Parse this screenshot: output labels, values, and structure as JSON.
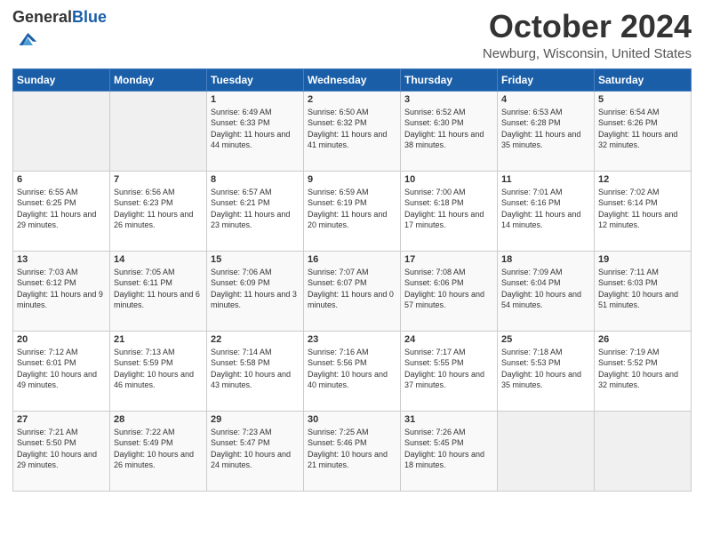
{
  "header": {
    "logo_general": "General",
    "logo_blue": "Blue",
    "month_title": "October 2024",
    "location": "Newburg, Wisconsin, United States"
  },
  "days_of_week": [
    "Sunday",
    "Monday",
    "Tuesday",
    "Wednesday",
    "Thursday",
    "Friday",
    "Saturday"
  ],
  "weeks": [
    [
      {
        "day": "",
        "sunrise": "",
        "sunset": "",
        "daylight": ""
      },
      {
        "day": "",
        "sunrise": "",
        "sunset": "",
        "daylight": ""
      },
      {
        "day": "1",
        "sunrise": "Sunrise: 6:49 AM",
        "sunset": "Sunset: 6:33 PM",
        "daylight": "Daylight: 11 hours and 44 minutes."
      },
      {
        "day": "2",
        "sunrise": "Sunrise: 6:50 AM",
        "sunset": "Sunset: 6:32 PM",
        "daylight": "Daylight: 11 hours and 41 minutes."
      },
      {
        "day": "3",
        "sunrise": "Sunrise: 6:52 AM",
        "sunset": "Sunset: 6:30 PM",
        "daylight": "Daylight: 11 hours and 38 minutes."
      },
      {
        "day": "4",
        "sunrise": "Sunrise: 6:53 AM",
        "sunset": "Sunset: 6:28 PM",
        "daylight": "Daylight: 11 hours and 35 minutes."
      },
      {
        "day": "5",
        "sunrise": "Sunrise: 6:54 AM",
        "sunset": "Sunset: 6:26 PM",
        "daylight": "Daylight: 11 hours and 32 minutes."
      }
    ],
    [
      {
        "day": "6",
        "sunrise": "Sunrise: 6:55 AM",
        "sunset": "Sunset: 6:25 PM",
        "daylight": "Daylight: 11 hours and 29 minutes."
      },
      {
        "day": "7",
        "sunrise": "Sunrise: 6:56 AM",
        "sunset": "Sunset: 6:23 PM",
        "daylight": "Daylight: 11 hours and 26 minutes."
      },
      {
        "day": "8",
        "sunrise": "Sunrise: 6:57 AM",
        "sunset": "Sunset: 6:21 PM",
        "daylight": "Daylight: 11 hours and 23 minutes."
      },
      {
        "day": "9",
        "sunrise": "Sunrise: 6:59 AM",
        "sunset": "Sunset: 6:19 PM",
        "daylight": "Daylight: 11 hours and 20 minutes."
      },
      {
        "day": "10",
        "sunrise": "Sunrise: 7:00 AM",
        "sunset": "Sunset: 6:18 PM",
        "daylight": "Daylight: 11 hours and 17 minutes."
      },
      {
        "day": "11",
        "sunrise": "Sunrise: 7:01 AM",
        "sunset": "Sunset: 6:16 PM",
        "daylight": "Daylight: 11 hours and 14 minutes."
      },
      {
        "day": "12",
        "sunrise": "Sunrise: 7:02 AM",
        "sunset": "Sunset: 6:14 PM",
        "daylight": "Daylight: 11 hours and 12 minutes."
      }
    ],
    [
      {
        "day": "13",
        "sunrise": "Sunrise: 7:03 AM",
        "sunset": "Sunset: 6:12 PM",
        "daylight": "Daylight: 11 hours and 9 minutes."
      },
      {
        "day": "14",
        "sunrise": "Sunrise: 7:05 AM",
        "sunset": "Sunset: 6:11 PM",
        "daylight": "Daylight: 11 hours and 6 minutes."
      },
      {
        "day": "15",
        "sunrise": "Sunrise: 7:06 AM",
        "sunset": "Sunset: 6:09 PM",
        "daylight": "Daylight: 11 hours and 3 minutes."
      },
      {
        "day": "16",
        "sunrise": "Sunrise: 7:07 AM",
        "sunset": "Sunset: 6:07 PM",
        "daylight": "Daylight: 11 hours and 0 minutes."
      },
      {
        "day": "17",
        "sunrise": "Sunrise: 7:08 AM",
        "sunset": "Sunset: 6:06 PM",
        "daylight": "Daylight: 10 hours and 57 minutes."
      },
      {
        "day": "18",
        "sunrise": "Sunrise: 7:09 AM",
        "sunset": "Sunset: 6:04 PM",
        "daylight": "Daylight: 10 hours and 54 minutes."
      },
      {
        "day": "19",
        "sunrise": "Sunrise: 7:11 AM",
        "sunset": "Sunset: 6:03 PM",
        "daylight": "Daylight: 10 hours and 51 minutes."
      }
    ],
    [
      {
        "day": "20",
        "sunrise": "Sunrise: 7:12 AM",
        "sunset": "Sunset: 6:01 PM",
        "daylight": "Daylight: 10 hours and 49 minutes."
      },
      {
        "day": "21",
        "sunrise": "Sunrise: 7:13 AM",
        "sunset": "Sunset: 5:59 PM",
        "daylight": "Daylight: 10 hours and 46 minutes."
      },
      {
        "day": "22",
        "sunrise": "Sunrise: 7:14 AM",
        "sunset": "Sunset: 5:58 PM",
        "daylight": "Daylight: 10 hours and 43 minutes."
      },
      {
        "day": "23",
        "sunrise": "Sunrise: 7:16 AM",
        "sunset": "Sunset: 5:56 PM",
        "daylight": "Daylight: 10 hours and 40 minutes."
      },
      {
        "day": "24",
        "sunrise": "Sunrise: 7:17 AM",
        "sunset": "Sunset: 5:55 PM",
        "daylight": "Daylight: 10 hours and 37 minutes."
      },
      {
        "day": "25",
        "sunrise": "Sunrise: 7:18 AM",
        "sunset": "Sunset: 5:53 PM",
        "daylight": "Daylight: 10 hours and 35 minutes."
      },
      {
        "day": "26",
        "sunrise": "Sunrise: 7:19 AM",
        "sunset": "Sunset: 5:52 PM",
        "daylight": "Daylight: 10 hours and 32 minutes."
      }
    ],
    [
      {
        "day": "27",
        "sunrise": "Sunrise: 7:21 AM",
        "sunset": "Sunset: 5:50 PM",
        "daylight": "Daylight: 10 hours and 29 minutes."
      },
      {
        "day": "28",
        "sunrise": "Sunrise: 7:22 AM",
        "sunset": "Sunset: 5:49 PM",
        "daylight": "Daylight: 10 hours and 26 minutes."
      },
      {
        "day": "29",
        "sunrise": "Sunrise: 7:23 AM",
        "sunset": "Sunset: 5:47 PM",
        "daylight": "Daylight: 10 hours and 24 minutes."
      },
      {
        "day": "30",
        "sunrise": "Sunrise: 7:25 AM",
        "sunset": "Sunset: 5:46 PM",
        "daylight": "Daylight: 10 hours and 21 minutes."
      },
      {
        "day": "31",
        "sunrise": "Sunrise: 7:26 AM",
        "sunset": "Sunset: 5:45 PM",
        "daylight": "Daylight: 10 hours and 18 minutes."
      },
      {
        "day": "",
        "sunrise": "",
        "sunset": "",
        "daylight": ""
      },
      {
        "day": "",
        "sunrise": "",
        "sunset": "",
        "daylight": ""
      }
    ]
  ]
}
